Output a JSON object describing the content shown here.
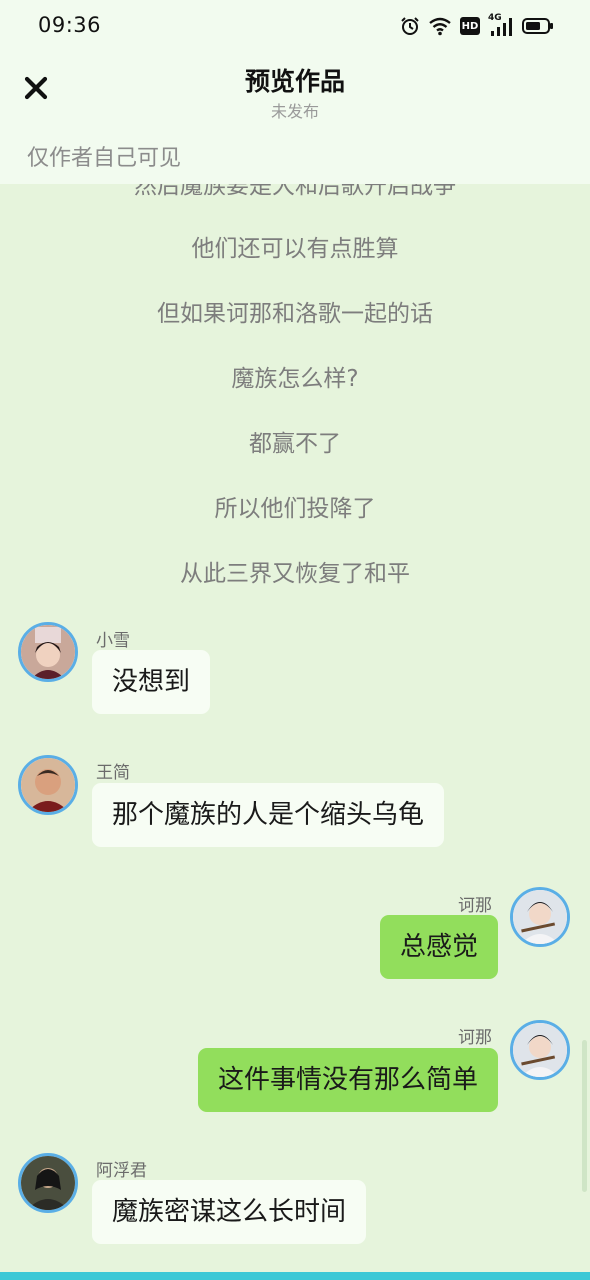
{
  "status_bar": {
    "time": "09:36",
    "hd_label": "HD",
    "network_label": "4G"
  },
  "header": {
    "title": "预览作品",
    "subtitle": "未发布",
    "private_note": "仅作者自己可见"
  },
  "narration": [
    "然后魔族要是大和后歌开启战争",
    "他们还可以有点胜算",
    "但如果诃那和洛歌一起的话",
    "魔族怎么样?",
    "都赢不了",
    "所以他们投降了",
    "从此三界又恢复了和平"
  ],
  "messages": [
    {
      "side": "left",
      "name": "小雪",
      "text": "没想到"
    },
    {
      "side": "left",
      "name": "王简",
      "text": "那个魔族的人是个缩头乌龟"
    },
    {
      "side": "right",
      "name": "诃那",
      "text": "总感觉"
    },
    {
      "side": "right",
      "name": "诃那",
      "text": "这件事情没有那么简单"
    },
    {
      "side": "left",
      "name": "阿浮君",
      "text": "魔族密谋这么长时间"
    }
  ],
  "colors": {
    "background": "#e6f4dc",
    "left_bubble": "#f7fdf4",
    "right_bubble": "#92de5c",
    "avatar_ring": "#5aaee6"
  }
}
